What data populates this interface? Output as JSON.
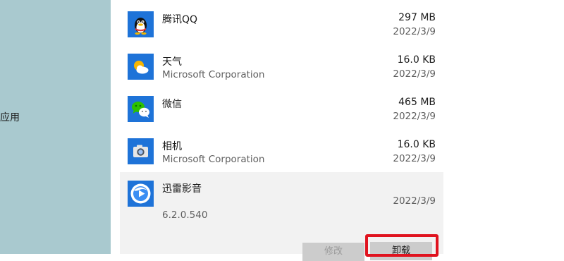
{
  "sidebar": {
    "label": "应用"
  },
  "apps": [
    {
      "name": "腾讯QQ",
      "publisher": "",
      "size": "297 MB",
      "date": "2022/3/9",
      "icon": "qq-penguin-icon"
    },
    {
      "name": "天气",
      "publisher": "Microsoft Corporation",
      "size": "16.0 KB",
      "date": "2022/3/9",
      "icon": "weather-icon"
    },
    {
      "name": "微信",
      "publisher": "",
      "size": "465 MB",
      "date": "2022/3/9",
      "icon": "wechat-icon"
    },
    {
      "name": "相机",
      "publisher": "Microsoft Corporation",
      "size": "16.0 KB",
      "date": "2022/3/9",
      "icon": "camera-icon"
    },
    {
      "name": "迅雷影音",
      "publisher": "",
      "version": "6.2.0.540",
      "size": "",
      "date": "2022/3/9",
      "icon": "xunlei-player-icon",
      "selected": true
    }
  ],
  "actions": {
    "modify_label": "修改",
    "uninstall_label": "卸载"
  },
  "colors": {
    "sidebar_bg": "#a9c9cf",
    "selected_row_bg": "#f2f2f2",
    "icon_tile_blue": "#1e73d8",
    "highlight_red": "#e0131f"
  }
}
